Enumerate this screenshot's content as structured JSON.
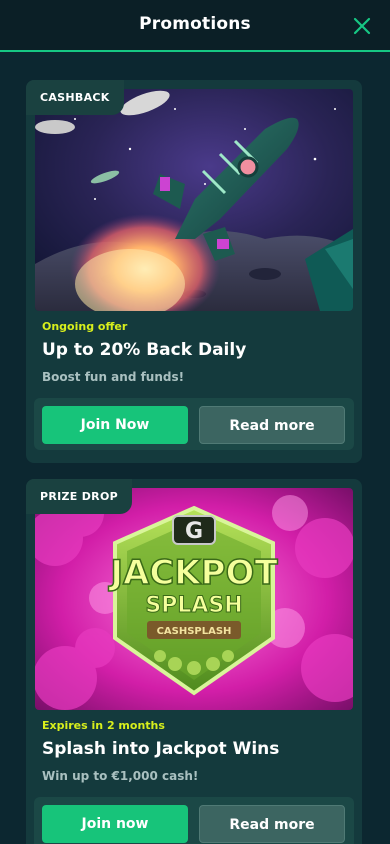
{
  "header": {
    "title": "Promotions",
    "close_icon": "close-icon"
  },
  "colors": {
    "accent_green": "#17c47a",
    "meta_yellow": "#d8ef1c",
    "card_bg": "#143a3d",
    "page_bg": "#0c2730"
  },
  "promotions": [
    {
      "badge": "CASHBACK",
      "meta": "Ongoing offer",
      "title": "Up to 20% Back Daily",
      "subtitle": "Boost fun and funds!",
      "primary_label": "Join Now",
      "secondary_label": "Read more",
      "image": "rocket-launch-illustration"
    },
    {
      "badge": "PRIZE DROP",
      "meta": "Expires in 2 months",
      "title": "Splash into Jackpot Wins",
      "subtitle": "Win up to €1,000 cash!",
      "primary_label": "Join now",
      "secondary_label": "Read more",
      "image": "jackpot-splash-logo",
      "logo_text": {
        "line1": "JACKPOT",
        "line2": "SPLASH",
        "line3": "CASHSPLASH"
      }
    }
  ]
}
